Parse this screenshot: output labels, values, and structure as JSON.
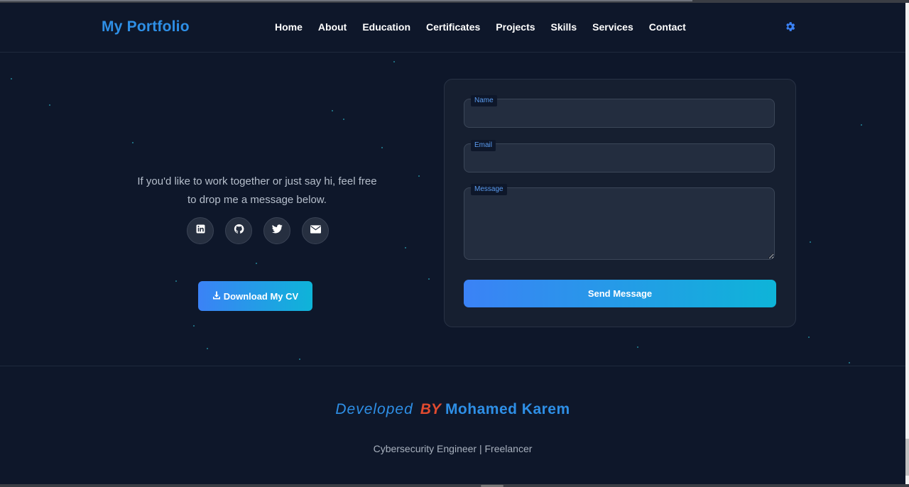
{
  "header": {
    "logo": "My Portfolio",
    "nav": [
      "Home",
      "About",
      "Education",
      "Certificates",
      "Projects",
      "Skills",
      "Services",
      "Contact"
    ],
    "theme_icon": "gear-icon"
  },
  "contact": {
    "intro": "If you'd like to work together or just say hi, feel free to drop me a message below.",
    "socials": [
      {
        "name": "linkedin",
        "icon": "linkedin-icon"
      },
      {
        "name": "github",
        "icon": "github-icon"
      },
      {
        "name": "twitter",
        "icon": "twitter-icon"
      },
      {
        "name": "email",
        "icon": "mail-icon"
      }
    ],
    "cv_label": "Download My CV",
    "form": {
      "name_label": "Name",
      "email_label": "Email",
      "message_label": "Message",
      "submit_label": "Send Message"
    }
  },
  "footer": {
    "credit_prefix": "Developed",
    "credit_by": "BY",
    "credit_name": "Mohamed Karem",
    "tagline": "Cybersecurity Engineer | Freelancer"
  },
  "colors": {
    "background": "#0e172a",
    "accent": "#2e8fe6",
    "by_accent": "#e04a2f",
    "button_gradient_start": "#3b82f6",
    "button_gradient_end": "#0eb4d8"
  }
}
